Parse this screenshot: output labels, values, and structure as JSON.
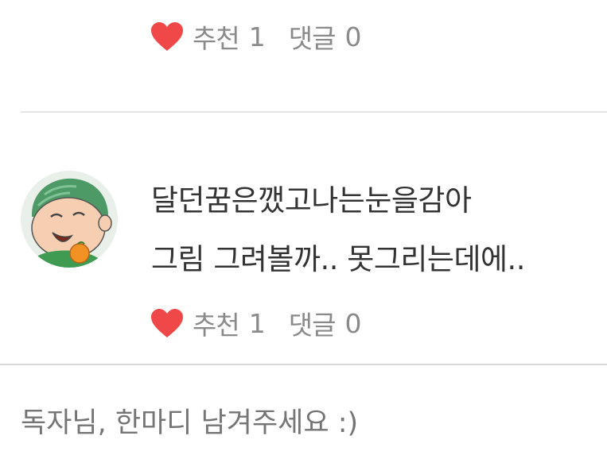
{
  "comments": [
    {
      "recommend_label": "추천",
      "recommend_count": "1",
      "reply_label": "댓글",
      "reply_count": "0"
    },
    {
      "avatar": "cartoon-boy-avatar",
      "line1": "달던꿈은깼고나는눈을감아",
      "line2": "그림 그려볼까.. 못그리는데에..",
      "recommend_label": "추천",
      "recommend_count": "1",
      "reply_label": "댓글",
      "reply_count": "0"
    }
  ],
  "reply_box": {
    "placeholder": "독자님, 한마디 남겨주세요 :)"
  },
  "colors": {
    "heart": "#f04848",
    "meta_text": "#8a8a8a",
    "comment_text": "#333333",
    "placeholder": "#a8a8a8"
  }
}
